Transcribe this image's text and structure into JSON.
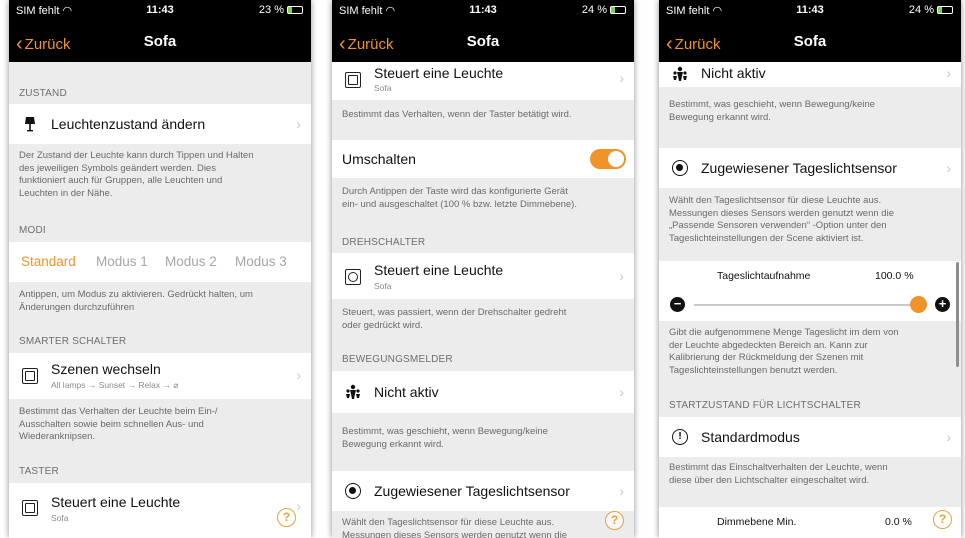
{
  "colors": {
    "accent": "#f0932b",
    "help": "#e8a33d",
    "statusbar": "#000000",
    "background": "#ececec"
  },
  "nav": {
    "back": "Zurück",
    "title": "Sofa"
  },
  "help_symbol": "?",
  "screens": [
    {
      "status": {
        "carrier": "SIM fehlt",
        "time": "11:43",
        "battery": "23 %"
      },
      "zustand": {
        "header": "ZUSTAND",
        "row_label": "Leuchtenzustand ändern",
        "row_icon": "lamp-icon",
        "desc1": "Der Zustand der Leuchte kann durch Tippen und Halten",
        "desc2": "des jeweiligen Symbols geändert werden. Dies",
        "desc3": "funktioniert auch für Gruppen, alle Leuchten und",
        "desc4": "Leuchten in der Nähe."
      },
      "modi": {
        "header": "MODI",
        "tabs": [
          "Standard",
          "Modus 1",
          "Modus 2",
          "Modus 3"
        ],
        "active_tab": "Standard",
        "desc1": "Antippen, um Modus zu aktivieren. Gedrückt halten, um",
        "desc2": "Änderungen durchzuführen"
      },
      "smarter": {
        "header": "SMARTER SCHALTER",
        "row_label": "Szenen wechseln",
        "row_sub": "All lamps → Sunset → Relax → ⌀",
        "desc1": "Bestimmt das Verhalten der Leuchte beim Ein-/",
        "desc2": "Ausschalten sowie beim schnellen Aus- und",
        "desc3": "Wiederanknipsen."
      },
      "taster": {
        "header": "TASTER",
        "row_label": "Steuert eine Leuchte",
        "row_sub": "Sofa"
      }
    },
    {
      "status": {
        "carrier": "SIM fehlt",
        "time": "11:43",
        "battery": "24 %"
      },
      "taster_row": {
        "label": "Steuert eine Leuchte",
        "sub": "Sofa"
      },
      "taster_desc": "Bestimmt das Verhalten, wenn der Taster betätigt wird.",
      "umschalten": {
        "label": "Umschalten",
        "on": true,
        "desc1": "Durch Antippen der Taste wird das konfigurierte Gerät",
        "desc2": "ein- und ausgeschaltet (100 % bzw. letzte Dimmebene)."
      },
      "drehschalter": {
        "header": "DREHSCHALTER",
        "row_label": "Steuert eine Leuchte",
        "row_sub": "Sofa",
        "desc1": "Steuert, was passiert, wenn der Drehschalter gedreht",
        "desc2": "oder gedrückt wird."
      },
      "bewegung": {
        "header": "BEWEGUNGSMELDER",
        "row_label": "Nicht aktiv",
        "desc1": "Bestimmt, was geschieht, wenn Bewegung/keine",
        "desc2": "Bewegung erkannt wird."
      },
      "tageslicht": {
        "row_label": "Zugewiesener Tageslichtsensor",
        "desc1": "Wählt den Tageslichtsensor für diese Leuchte aus.",
        "desc2": "Messungen dieses Sensors werden genutzt wenn die"
      }
    },
    {
      "status": {
        "carrier": "SIM fehlt",
        "time": "11:43",
        "battery": "24 %"
      },
      "bewegung_row": {
        "label": "Nicht aktiv"
      },
      "bewegung_desc1": "Bestimmt, was geschieht, wenn Bewegung/keine",
      "bewegung_desc2": "Bewegung erkannt wird.",
      "tageslicht": {
        "row_label": "Zugewiesener Tageslichtsensor",
        "desc1": "Wählt den Tageslichtsensor für diese Leuchte aus.",
        "desc2": "Messungen dieses Sensors werden genutzt wenn die",
        "desc3": "„Passende Sensoren verwenden“ -Option unter den",
        "desc4": "Tageslichteinstellungen der Scene aktiviert ist."
      },
      "aufnahme": {
        "label": "Tageslichtaufnahme",
        "value": "100.0 %",
        "fraction": 1.0,
        "minus": "−",
        "plus": "+",
        "desc1": "Gibt die aufgenommene Menge Tageslicht im dem von",
        "desc2": "der Leuchte abgedeckten Bereich an. Kann zur",
        "desc3": "Kalibrierung der Rückmeldung der Szenen mit",
        "desc4": "Tageslichteinstellungen benutzt werden."
      },
      "startzustand": {
        "header": "STARTZUSTAND FÜR LICHTSCHALTER",
        "row_label": "Standardmodus",
        "desc1": "Bestimmt das Einschaltverhalten der Leuchte, wenn",
        "desc2": "diese über den Lichtschalter eingeschaltet wird."
      },
      "dimmebene": {
        "label": "Dimmebene Min.",
        "value": "0.0 %"
      }
    }
  ]
}
